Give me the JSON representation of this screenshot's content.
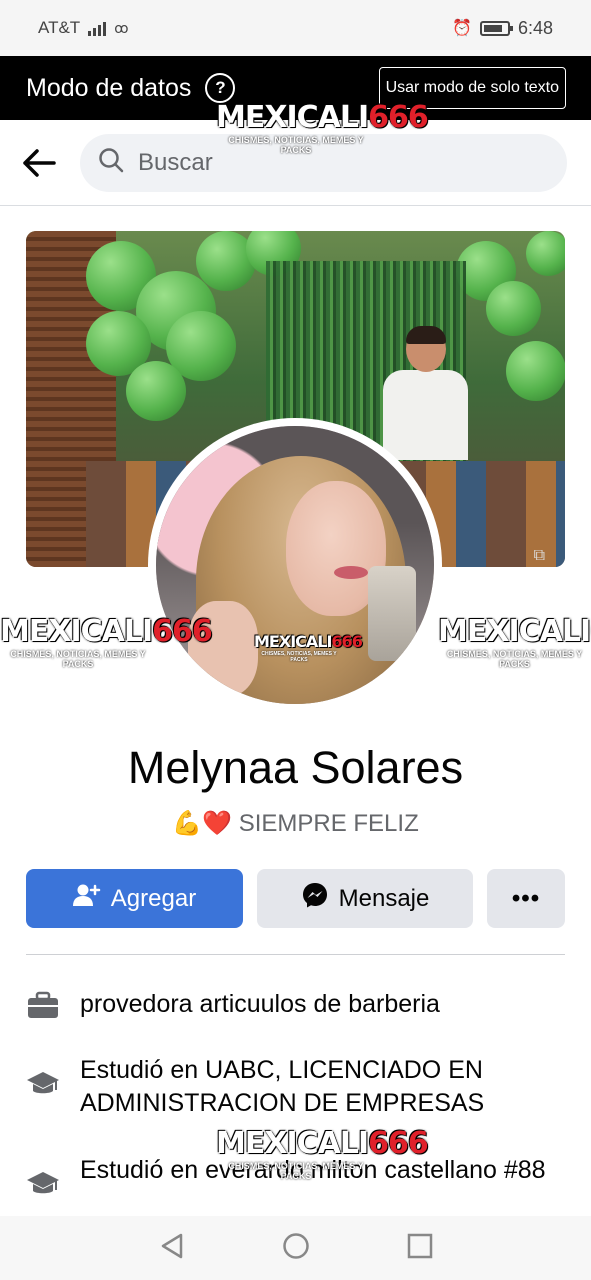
{
  "status_bar": {
    "carrier": "AT&T",
    "time": "6:48"
  },
  "data_mode": {
    "title": "Modo de datos",
    "help": "?",
    "text_only_button": "Usar modo de solo texto"
  },
  "search": {
    "placeholder": "Buscar"
  },
  "watermark": {
    "brand": "MEXICALI",
    "number": "666",
    "tagline": "CHISMES, NOTICIAS, MEMES Y PACKS"
  },
  "profile": {
    "name": "Melynaa Solares",
    "bio_emoji": "💪❤️",
    "bio": "SIEMPRE FELIZ"
  },
  "actions": {
    "add_label": "Agregar",
    "message_label": "Mensaje",
    "more_label": "•••"
  },
  "details": [
    {
      "icon": "briefcase-icon",
      "text": "provedora articuulos de barberia"
    },
    {
      "icon": "graduation-cap-icon",
      "text": "Estudió en UABC, LICENCIADO EN ADMINISTRACION DE EMPRESAS"
    },
    {
      "icon": "graduation-cap-icon",
      "text": "Estudió en everardo milton castellano #88"
    }
  ],
  "colors": {
    "primary_button": "#3b74d9",
    "secondary_button": "#e4e6eb",
    "data_mode_bar": "#000000",
    "watermark_number": "#e0202a"
  }
}
